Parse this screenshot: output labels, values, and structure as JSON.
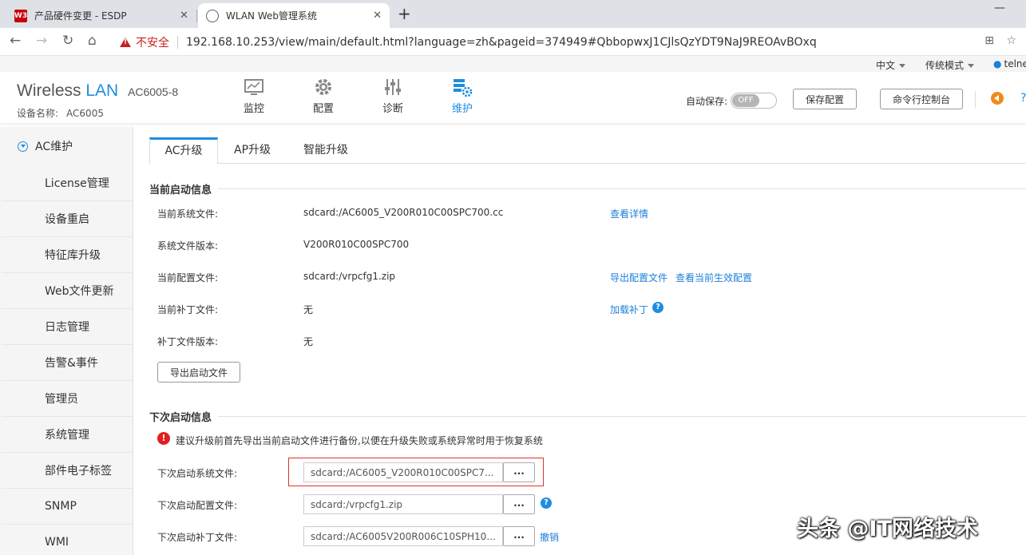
{
  "browser": {
    "tabs": [
      {
        "title": "产品硬件变更 - ESDP",
        "favicon": "W3"
      },
      {
        "title": "WLAN Web管理系统",
        "favicon": "globe"
      }
    ],
    "new_tab": "+",
    "minimize": "—",
    "security_label": "不安全",
    "url": "192.168.10.253/view/main/default.html?language=zh&pageid=374949#QbbopwxJ1CJlsQzYDT9NaJ9REOAvBOxq"
  },
  "topbar": {
    "language": "中文",
    "mode": "传统模式",
    "user": "telne"
  },
  "header": {
    "brand_main": "Wireless",
    "brand_lan": "LAN",
    "model": "AC6005-8",
    "device_label": "设备名称:",
    "device_name": "AC6005",
    "menu": [
      {
        "label": "监控",
        "icon": "monitor-icon"
      },
      {
        "label": "配置",
        "icon": "gear-icon"
      },
      {
        "label": "诊断",
        "icon": "sliders-icon"
      },
      {
        "label": "维护",
        "icon": "maintenance-icon"
      }
    ],
    "autosave_label": "自动保存:",
    "autosave_state": "OFF",
    "save_config": "保存配置",
    "cli_console": "命令行控制台",
    "accent": "#1e8de0"
  },
  "sidebar": {
    "section": "AC维护",
    "items": [
      "License管理",
      "设备重启",
      "特征库升级",
      "Web文件更新",
      "日志管理",
      "告警&事件",
      "管理员",
      "系统管理",
      "部件电子标签",
      "SNMP",
      "WMI"
    ]
  },
  "tabs": [
    "AC升级",
    "AP升级",
    "智能升级"
  ],
  "current": {
    "title": "当前启动信息",
    "rows": [
      {
        "label": "当前系统文件:",
        "value": "sdcard:/AC6005_V200R010C00SPC700.cc"
      },
      {
        "label": "系统文件版本:",
        "value": "V200R010C00SPC700"
      },
      {
        "label": "当前配置文件:",
        "value": "sdcard:/vrpcfg1.zip"
      },
      {
        "label": "当前补丁文件:",
        "value": "无"
      },
      {
        "label": "补丁文件版本:",
        "value": "无"
      }
    ],
    "view_details": "查看详情",
    "export_config": "导出配置文件",
    "view_effective": "查看当前生效配置",
    "load_patch": "加载补丁",
    "export_button": "导出启动文件"
  },
  "next": {
    "title": "下次启动信息",
    "warning": "建议升级前首先导出当前启动文件进行备份,以便在升级失败或系统异常时用于恢复系统",
    "rows": [
      {
        "label": "下次启动系统文件:",
        "value": "sdcard:/AC6005_V200R010C00SPC7..."
      },
      {
        "label": "下次启动配置文件:",
        "value": "sdcard:/vrpcfg1.zip"
      },
      {
        "label": "下次启动补丁文件:",
        "value": "sdcard:/AC6005V200R006C10SPH10..."
      }
    ],
    "browse": "...",
    "cancel": "撤销"
  },
  "watermark": "头条 @IT网络技术"
}
